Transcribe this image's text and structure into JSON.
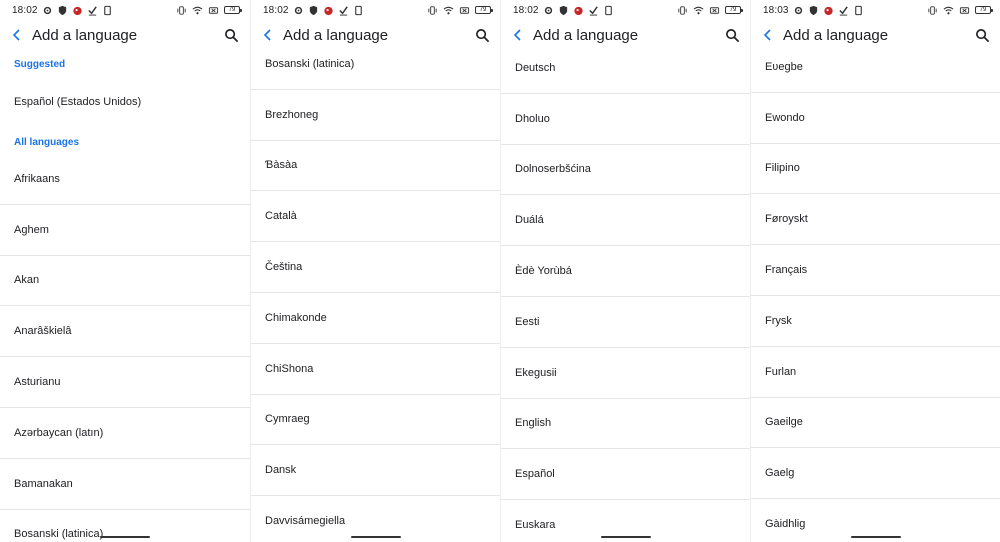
{
  "panels": [
    {
      "status": {
        "time": "18:02",
        "battery": "79"
      },
      "title": "Add a language",
      "suggested_label": "Suggested",
      "suggested": [
        "Español (Estados Unidos)"
      ],
      "all_label": "All languages",
      "items": [
        "Afrikaans",
        "Aghem",
        "Akan",
        "Anarâškielâ",
        "Asturianu",
        "Azərbaycan (latın)",
        "Bamanakan",
        "Bosanski (latinica)"
      ]
    },
    {
      "status": {
        "time": "18:02",
        "battery": "79"
      },
      "title": "Add a language",
      "items": [
        "Bosanski (latinica)",
        "Brezhoneg",
        "Ɓàsàa",
        "Català",
        "Čeština",
        "Chimakonde",
        "ChiShona",
        "Cymraeg",
        "Dansk",
        "Davvisámegiella"
      ]
    },
    {
      "status": {
        "time": "18:02",
        "battery": "79"
      },
      "title": "Add a language",
      "items": [
        "Deutsch",
        "Dholuo",
        "Dolnoserbšćina",
        "Duálá",
        "Èdè Yorùbá",
        "Eesti",
        "Ekegusii",
        "English",
        "Español",
        "Euskara"
      ]
    },
    {
      "status": {
        "time": "18:03",
        "battery": "79"
      },
      "title": "Add a language",
      "items": [
        "Eʋegbe",
        "Ewondo",
        "Filipino",
        "Føroyskt",
        "Français",
        "Frysk",
        "Furlan",
        "Gaeilge",
        "Gaelg",
        "Gàidhlig"
      ]
    }
  ]
}
